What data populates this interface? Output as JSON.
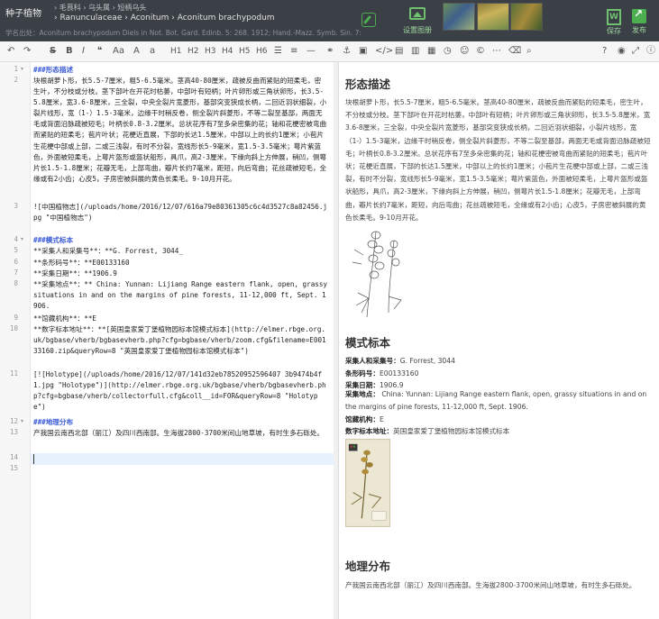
{
  "header": {
    "brand": "种子植物",
    "breadcrumb_top": [
      "毛茛科",
      "乌头属",
      "短柄乌头"
    ],
    "breadcrumb_sub": [
      "Ranunculaceae",
      "Aconitum",
      "Aconitum brachypodum"
    ],
    "citation": "学名出处：Aconitum brachypodum Diels in Not. Bot. Gard. Edinb. 5: 268. 1912; Hand.-Mazz. Symb. Sin. 7: 288. 1931",
    "cover_label": "设置图册",
    "save_label": "保存",
    "publish_label": "发布"
  },
  "toolbar": {
    "icons": [
      "undo-icon",
      "redo-icon",
      "bold-icon",
      "strikethrough-icon",
      "italic-icon",
      "quote-icon",
      "uppercase-icon",
      "lowercase-icon",
      "h1-icon",
      "h2-icon",
      "h3-icon",
      "h4-icon",
      "h5-icon",
      "h6-icon",
      "unordered-list-icon",
      "ordered-list-icon",
      "hr-icon",
      "link-icon",
      "reference-link-icon",
      "image-icon",
      "code-icon",
      "preformatted-icon",
      "code-block-icon",
      "table-icon",
      "datetime-icon",
      "emoji-icon",
      "html-entities-icon",
      "pagebreak-icon",
      "watch-icon",
      "eye-icon",
      "clear-icon",
      "search-icon",
      "help-icon",
      "info-icon"
    ],
    "labels": [
      "S",
      "B",
      "I",
      "❝",
      "Aa",
      "A",
      "a",
      "H1",
      "H2",
      "H3",
      "H4",
      "H5",
      "H6"
    ]
  },
  "editor": {
    "lines": [
      {
        "n": "1",
        "fold": true,
        "parts": [
          {
            "t": "###形态描述",
            "c": "h"
          }
        ]
      },
      {
        "n": "2",
        "parts": [
          {
            "t": "块根胡萝卜形，长5.5-7厘米，粗5-6.5毫米。茎高40-80厘米，疏被反曲而紧贴的短柔毛，密生叶，不分枝或分枝。茎下部叶在开花时枯萎，中部叶有短柄；叶片卵形或三角状卵形，长3.5-5.8厘米，宽3.6-8厘米，三全裂，中央全裂片宽菱形，基部突变狭成长柄，二回近羽状细裂，小裂片线形，宽（1-）1.5-3毫米，边缘干时稍反卷，侧全裂片斜菱形，不等二裂至基部，两面无毛或背面沿脉疏被短毛；叶柄长0.8-3.2厘米。总状花序有7至多朵密集的花；轴和花梗密被弯曲而紧贴的短柔毛；苞片叶状；花梗近直展，下部的长达1.5厘米，中部以上的长约1厘米；小苞片生花梗中部或上部，二或三浅裂，有时不分裂，宽线形长5-9毫米，宽1.5-3.5毫米；萼片紫蓝色，外面被短柔毛，上萼片盔形或盔状船形，具爪，高2-3厘米，下缘向斜上方伸展，稍凹，侧萼片长1.5-1.8厘米；花瓣无毛，上部弯曲，瓣片长约7毫米，距短，向后弯曲；花丝疏被短毛，全缘或有2小齿；心皮5，子房密被斜展的黄色长柔毛。9-10月开花。",
            "c": "k"
          }
        ]
      },
      {
        "n": "3",
        "parts": [
          {
            "t": "![中国植物志](/uploads/home/2016/12/07/616a79e80361305c6c4d3527c8a82456.jpg \"中国植物志\")",
            "c": "img"
          }
        ]
      },
      {
        "n": "4",
        "fold": true,
        "parts": [
          {
            "t": "###模式标本",
            "c": "h"
          }
        ]
      },
      {
        "n": "5",
        "parts": [
          {
            "t": "**采集人和采集号**：**G. Forrest, 3044_",
            "c": "k"
          }
        ]
      },
      {
        "n": "6",
        "parts": [
          {
            "t": "**条形码号**：**E00133160",
            "c": "k"
          }
        ]
      },
      {
        "n": "7",
        "parts": [
          {
            "t": "**采集日期**：**1906.9",
            "c": "k"
          }
        ]
      },
      {
        "n": "8",
        "parts": [
          {
            "t": "**采集地点**：** China: Yunnan: Lijiang Range eastern flank, open, grassy situations in and on the margins of pine forests, 11-12,000 ft, Sept. 1906.",
            "c": "k"
          }
        ]
      },
      {
        "n": "9",
        "parts": [
          {
            "t": "**馆藏机构**：**E",
            "c": "k"
          }
        ]
      },
      {
        "n": "10",
        "parts": [
          {
            "t": "**数字标本地址**：**[英国皇家爱丁堡植物园标本馆模式标本](http://elmer.rbge.org.uk/bgbase/vherb/bgbasevherb.php?cfg=bgbase/vherb/zoom.cfg&filename=E00133160.zip&queryRow=8 \"英国皇家爱丁堡植物园标本馆模式标本\")",
            "c": "k"
          }
        ]
      },
      {
        "n": "11",
        "parts": [
          {
            "t": "[![Holotype](/uploads/home/2016/12/07/141d32eb78520952596407 3b9474b4f1.jpg \"Holotype\")](http://elmer.rbge.org.uk/bgbase/vherb/bgbasevherb.php?cfg=bgbase/vherb/collectorfull.cfg&coll__id=FOR&queryRow=8 \"Holotype\")",
            "c": "k"
          }
        ]
      },
      {
        "n": "12",
        "fold": true,
        "parts": [
          {
            "t": "###地理分布",
            "c": "h"
          }
        ]
      },
      {
        "n": "13",
        "parts": [
          {
            "t": "产我国云南西北部（丽江）及四川西南部。生海拔2800-3700米间山地草坡，有时生多石砾处。",
            "c": "k"
          }
        ]
      },
      {
        "n": "14",
        "parts": [
          {
            "t": "",
            "c": "k"
          }
        ]
      },
      {
        "n": "15",
        "parts": [
          {
            "t": "",
            "c": "k"
          }
        ]
      }
    ]
  },
  "preview": {
    "h_morph": "形态描述",
    "morph_text": "块根胡萝卜形，长5.5-7厘米，粗5-6.5毫米。茎高40-80厘米，疏被反曲而紧贴的短柔毛，密生叶，不分枝或分枝。茎下部叶在开花时枯萎，中部叶有短柄；叶片卵形或三角状卵形，长3.5-5.8厘米，宽3.6-8厘米，三全裂，中央全裂片宽菱形，基部突变狭成长柄，二回近羽状细裂，小裂片线形，宽（1-）1.5-3毫米，边缘干时稍反卷，侧全裂片斜菱形，不等二裂至基部，两面无毛或背面沿脉疏被短毛；叶柄长0.8-3.2厘米。总状花序有7至多朵密集的花；轴和花梗密被弯曲而紧贴的短柔毛；苞片叶状；花梗近直展，下部的长达1.5厘米，中部以上的长约1厘米；小苞片生花梗中部或上部，二或三浅裂，有时不分裂，宽线形长5-9毫米，宽1.5-3.5毫米；萼片紫蓝色，外面被短柔毛，上萼片盔形或盔状船形，具爪，高2-3厘米，下缘向斜上方伸展，稍凹，侧萼片长1.5-1.8厘米；花瓣无毛，上部弯曲，瓣片长约7毫米，距短，向后弯曲；花丝疏被短毛，全缘或有2小齿；心皮5，子房密被斜展的黄色长柔毛。9-10月开花。",
    "h_type": "模式标本",
    "collector_label": "采集人和采集号：",
    "collector_value": "G. Forrest, 3044",
    "barcode_label": "条形码号：",
    "barcode_value": "E00133160",
    "date_label": "采集日期：",
    "date_value": "1906.9",
    "locality_label": "采集地点：",
    "locality_value": " China: Yunnan: Lijiang Range eastern flank, open, grassy situations in and on the margins of pine forests, 11-12,000 ft, Sept. 1906.",
    "institution_label": "馆藏机构：",
    "institution_value": "E",
    "digital_label": "数字标本地址：",
    "digital_link": "英国皇家爱丁堡植物园标本馆模式标本",
    "h_dist": "地理分布",
    "dist_text": "产我国云南西北部（丽江）及四川西南部。生海拔2800-3700米间山地草坡，有时生多石砾处。"
  },
  "colors": {
    "accent": "#4caf50",
    "heading": "#3b5bd6",
    "link": "#3b6fb6",
    "topbar": "#3b4046"
  }
}
